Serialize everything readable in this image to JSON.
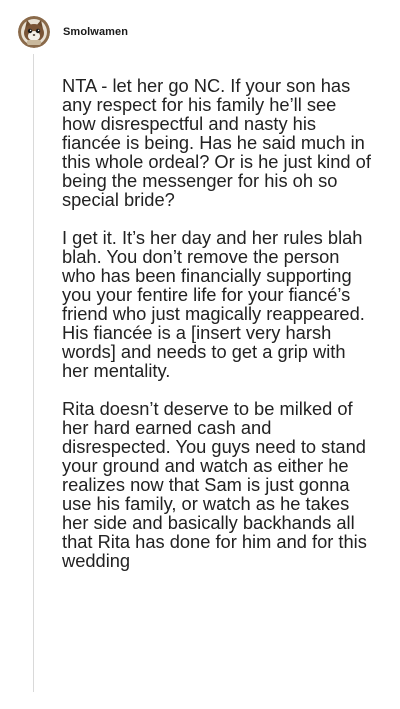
{
  "comment": {
    "username": "Smolwamen",
    "avatar_icon": "cat-avatar-icon",
    "paragraphs": [
      "NTA - let her go NC. If your son has any respect for his family he’ll see how disrespectful and nasty his fiancée is being. Has he said much in this whole ordeal? Or is he just kind of being the messenger for his oh so special bride?",
      "I get it. It’s her day and her rules blah blah. You don’t remove the person who has been financially supporting you your fentire life for your fiancé’s friend who just magically reappeared. His fiancée is a [insert very harsh words] and needs to get a grip with her mentality.",
      "Rita doesn’t deserve to be milked of her hard earned cash and disrespected. You guys need to stand your ground and watch as either he realizes now that Sam is just gonna use his family, or watch as he takes her side and basically backhands all that Rita has done for him and for this wedding"
    ]
  }
}
